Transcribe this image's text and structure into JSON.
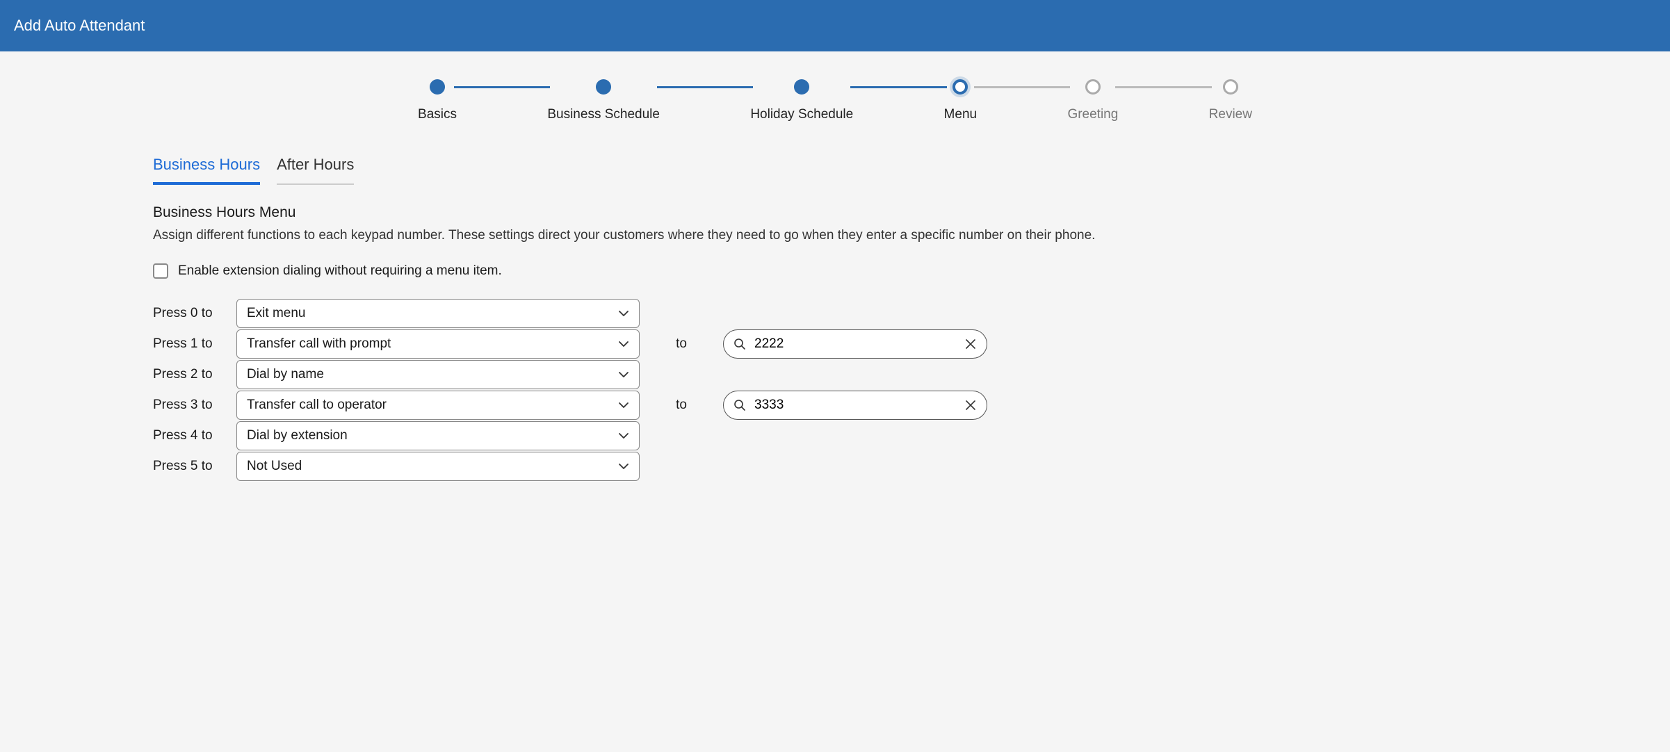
{
  "header": {
    "title": "Add Auto Attendant"
  },
  "stepper": [
    {
      "label": "Basics",
      "state": "done"
    },
    {
      "label": "Business Schedule",
      "state": "done"
    },
    {
      "label": "Holiday Schedule",
      "state": "done"
    },
    {
      "label": "Menu",
      "state": "active"
    },
    {
      "label": "Greeting",
      "state": "pending"
    },
    {
      "label": "Review",
      "state": "pending"
    }
  ],
  "tabs": [
    {
      "label": "Business Hours",
      "active": true
    },
    {
      "label": "After Hours",
      "active": false
    }
  ],
  "section": {
    "title": "Business Hours Menu",
    "description": "Assign different functions to each keypad number. These settings direct your customers where they need to go when they enter a specific number on their phone."
  },
  "extension_checkbox": {
    "label": "Enable extension dialing without requiring a menu item.",
    "checked": false
  },
  "to_label": "to",
  "rows": [
    {
      "press": "Press 0 to",
      "action": "Exit menu",
      "target": null
    },
    {
      "press": "Press 1 to",
      "action": "Transfer call with prompt",
      "target": "2222"
    },
    {
      "press": "Press 2 to",
      "action": "Dial by name",
      "target": null
    },
    {
      "press": "Press 3 to",
      "action": "Transfer call to operator",
      "target": "3333"
    },
    {
      "press": "Press 4 to",
      "action": "Dial by extension",
      "target": null
    },
    {
      "press": "Press 5 to",
      "action": "Not Used",
      "target": null
    }
  ]
}
